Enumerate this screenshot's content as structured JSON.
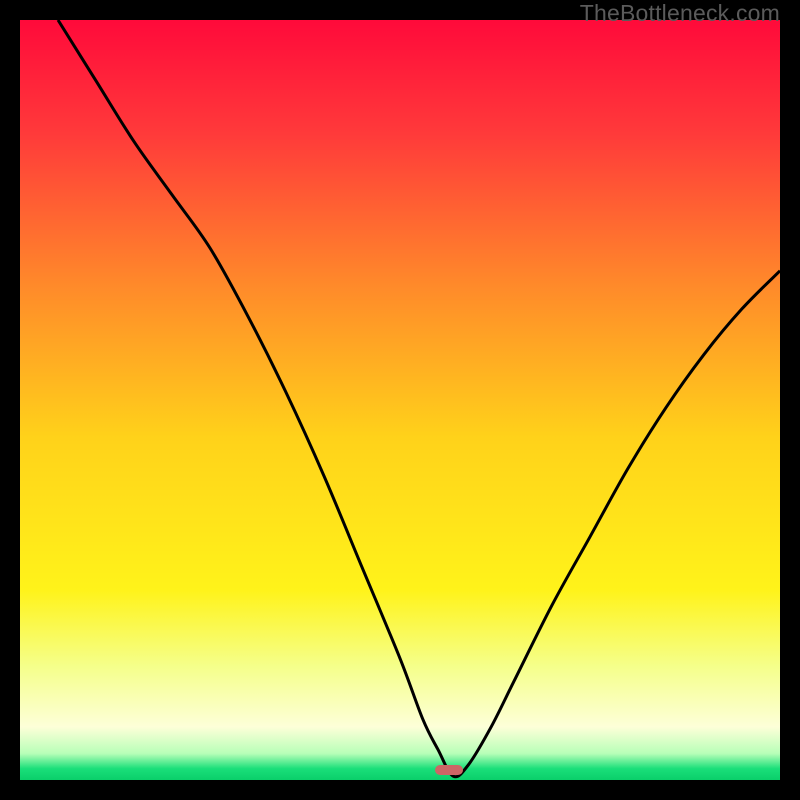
{
  "watermark": "TheBottleneck.com",
  "marker": {
    "x_frac": 0.565,
    "y_frac": 0.987
  },
  "chart_data": {
    "type": "line",
    "title": "",
    "xlabel": "",
    "ylabel": "",
    "xlim": [
      0,
      100
    ],
    "ylim": [
      0,
      100
    ],
    "x": [
      5,
      10,
      15,
      20,
      25,
      30,
      35,
      40,
      45,
      50,
      53,
      55,
      57,
      59,
      62,
      65,
      70,
      75,
      80,
      85,
      90,
      95,
      100
    ],
    "values": [
      100,
      92,
      84,
      77,
      70,
      61,
      51,
      40,
      28,
      16,
      8,
      4,
      0.5,
      2,
      7,
      13,
      23,
      32,
      41,
      49,
      56,
      62,
      67
    ],
    "series": [
      {
        "name": "bottleneck-curve",
        "color": "#000000"
      }
    ],
    "background_gradient": {
      "stops": [
        {
          "pos": 0.0,
          "color": "#ff0a3a"
        },
        {
          "pos": 0.15,
          "color": "#ff3a3a"
        },
        {
          "pos": 0.35,
          "color": "#ff8a2a"
        },
        {
          "pos": 0.55,
          "color": "#ffd21a"
        },
        {
          "pos": 0.75,
          "color": "#fff31a"
        },
        {
          "pos": 0.85,
          "color": "#f5ff8a"
        },
        {
          "pos": 0.93,
          "color": "#fdffd8"
        },
        {
          "pos": 0.965,
          "color": "#b8ffb8"
        },
        {
          "pos": 0.985,
          "color": "#1adf7a"
        },
        {
          "pos": 1.0,
          "color": "#0acf6a"
        }
      ]
    },
    "marker": {
      "x": 57,
      "y": 0,
      "color": "#c26464"
    }
  }
}
